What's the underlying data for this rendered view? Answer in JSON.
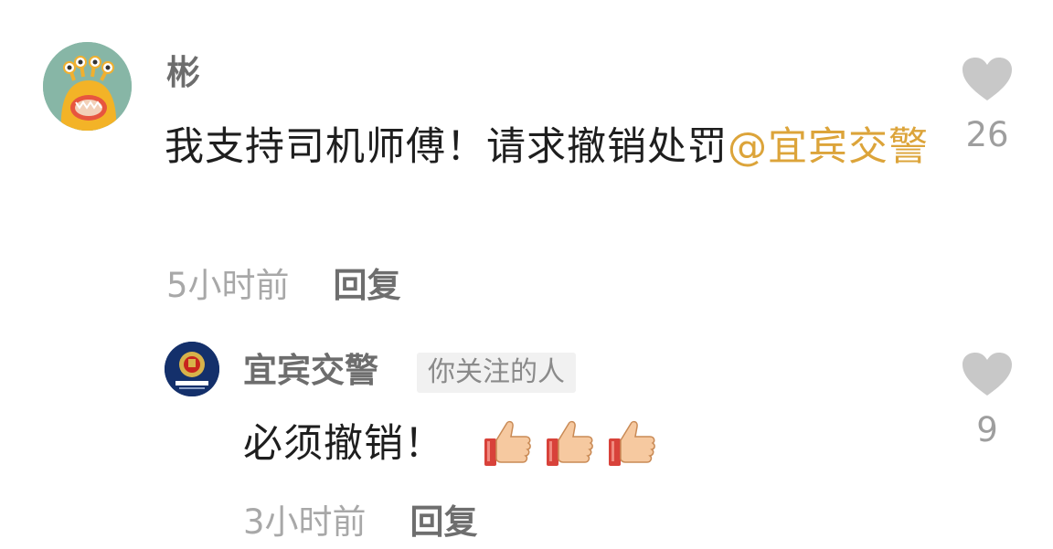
{
  "comment": {
    "username": "彬",
    "text": "我支持司机师傅！请求撤销处罚",
    "mention": "@宜宾交警",
    "time": "5小时前",
    "reply_label": "回复",
    "likes": "26",
    "avatar_icon": "yellow-monster-avatar"
  },
  "reply": {
    "username": "宜宾交警",
    "badge": "你关注的人",
    "text": "必须撤销！",
    "emoji": [
      "thumbs-up",
      "thumbs-up",
      "thumbs-up"
    ],
    "time": "3小时前",
    "reply_label": "回复",
    "likes": "9",
    "avatar_icon": "police-emblem-avatar"
  },
  "colors": {
    "mention": "#dca43a",
    "heart": "#c8c8c8",
    "text": "#1e1e1e",
    "muted": "#a8a8a8"
  }
}
